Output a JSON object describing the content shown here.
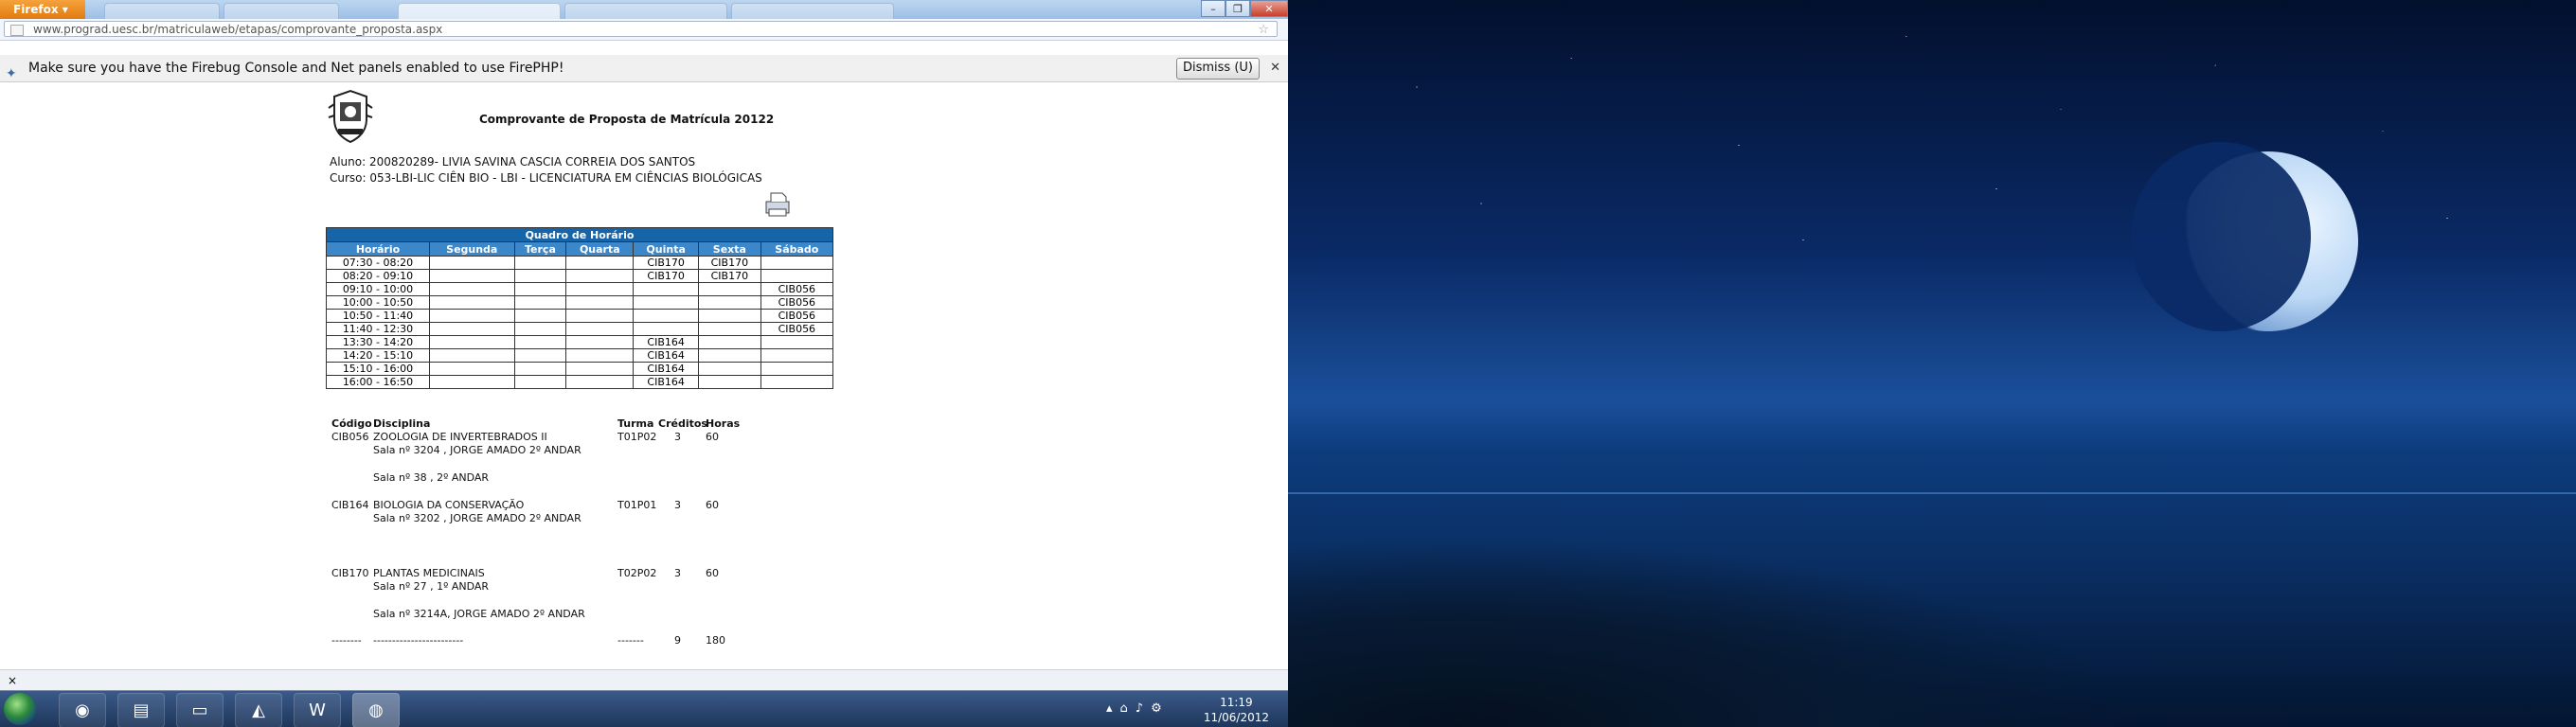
{
  "browser": {
    "menu_label": "Firefox",
    "url": "www.prograd.uesc.br/matriculaweb/etapas/comprovante_proposta.aspx",
    "firephp_message": "Make sure you have the Firebug Console and Net panels enabled to use FirePHP!",
    "dismiss_label": "Dismiss (U)",
    "status_close": "×"
  },
  "page": {
    "title": "Comprovante de Proposta de Matrícula 20122",
    "aluno": "Aluno: 200820289- LIVIA SAVINA CASCIA CORREIA DOS SANTOS",
    "curso": "Curso: 053-LBI-LIC CIÊN BIO - LBI - LICENCIATURA EM CIÊNCIAS BIOLÓGICAS"
  },
  "schedule": {
    "caption": "Quadro de Horário",
    "headers": [
      "Horário",
      "Segunda",
      "Terça",
      "Quarta",
      "Quinta",
      "Sexta",
      "Sábado"
    ],
    "rows": [
      [
        "07:30 - 08:20",
        "",
        "",
        "",
        "CIB170",
        "CIB170",
        ""
      ],
      [
        "08:20 - 09:10",
        "",
        "",
        "",
        "CIB170",
        "CIB170",
        ""
      ],
      [
        "09:10 - 10:00",
        "",
        "",
        "",
        "",
        "",
        "CIB056"
      ],
      [
        "10:00 - 10:50",
        "",
        "",
        "",
        "",
        "",
        "CIB056"
      ],
      [
        "10:50 - 11:40",
        "",
        "",
        "",
        "",
        "",
        "CIB056"
      ],
      [
        "11:40 - 12:30",
        "",
        "",
        "",
        "",
        "",
        "CIB056"
      ],
      [
        "13:30 - 14:20",
        "",
        "",
        "",
        "CIB164",
        "",
        ""
      ],
      [
        "14:20 - 15:10",
        "",
        "",
        "",
        "CIB164",
        "",
        ""
      ],
      [
        "15:10 - 16:00",
        "",
        "",
        "",
        "CIB164",
        "",
        ""
      ],
      [
        "16:00 - 16:50",
        "",
        "",
        "",
        "CIB164",
        "",
        ""
      ]
    ]
  },
  "disciplines": {
    "headers": {
      "code": "Código",
      "name": "Disciplina",
      "turma": "Turma",
      "creditos": "Créditos",
      "horas": "Horas"
    },
    "items": [
      {
        "code": "CIB056",
        "name": "ZOOLOGIA DE INVERTEBRADOS II",
        "turma": "T01P02",
        "creditos": "3",
        "horas": "60",
        "rooms": [
          "Sala nº 3204 , JORGE AMADO 2º ANDAR",
          "Sala nº 38 , 2º ANDAR"
        ]
      },
      {
        "code": "CIB164",
        "name": "BIOLOGIA DA CONSERVAÇÃO",
        "turma": "T01P01",
        "creditos": "3",
        "horas": "60",
        "rooms": [
          "Sala nº 3202 , JORGE AMADO 2º ANDAR"
        ]
      },
      {
        "code": "CIB170",
        "name": "PLANTAS MEDICINAIS",
        "turma": "T02P02",
        "creditos": "3",
        "horas": "60",
        "rooms": [
          "Sala nº 27 , 1º ANDAR",
          "Sala nº 3214A, JORGE AMADO 2º ANDAR"
        ]
      }
    ],
    "totals": {
      "dashes_code": "--------",
      "dashes_name": "------------------------",
      "dashes_turma": "-------",
      "creditos": "9",
      "horas": "180"
    }
  },
  "taskbar": {
    "time": "11:19",
    "date": "11/06/2012"
  },
  "colors": {
    "table_caption": "#1565a8",
    "table_header": "#3b87c9",
    "firefox_orange": "#e07b10"
  }
}
